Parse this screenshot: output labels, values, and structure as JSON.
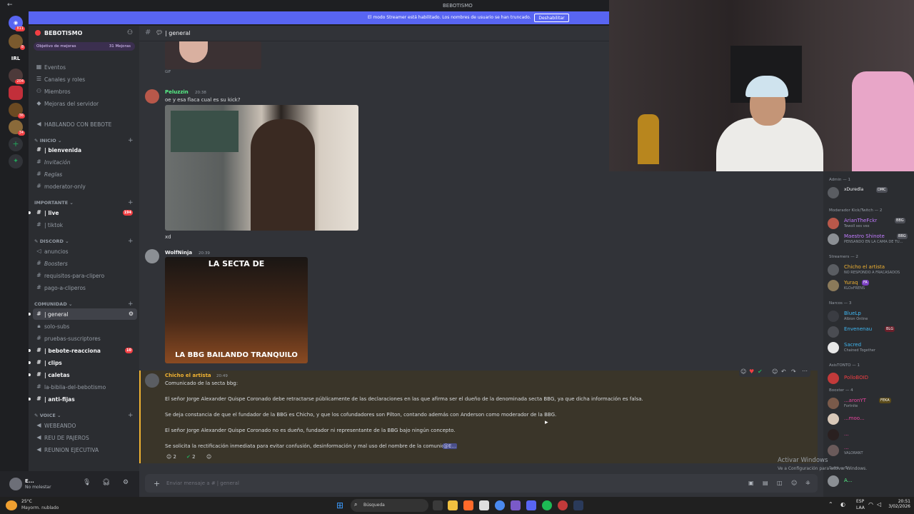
{
  "window": {
    "title": "BEBOTISMO"
  },
  "streamer_bar": {
    "text": "El modo Streamer está habilitado. Los nombres de usuario se han truncado.",
    "button": "Deshabilitar"
  },
  "rail": {
    "badges": [
      "811",
      "8",
      "204",
      "36",
      "34"
    ],
    "label_irl": "IRL"
  },
  "guild": {
    "name": "BEBOTISMO",
    "boost_goal": "Objetivo de mejoras",
    "boost_count": "31 Mejoras",
    "menu": [
      "Eventos",
      "Canales y roles",
      "Miembros",
      "Mejoras del servidor"
    ],
    "hablando": "HABLANDO CON BEBOTE"
  },
  "channels": {
    "cat_inicio": "INICIO",
    "inicio": [
      "| bienvenida",
      "Invitación",
      "Reglas",
      "moderator-only"
    ],
    "cat_importante": "IMPORTANTE",
    "importante": [
      "| live",
      "| tiktok"
    ],
    "live_badge": "194",
    "cat_discord": "DISCORD",
    "discord": [
      "anuncios",
      "Boosters",
      "requisitos-para-clipero",
      "pago-a-cliperos"
    ],
    "cat_comunidad": "COMUNIDAD",
    "comunidad": [
      "| general",
      "solo-subs",
      "pruebas-suscriptores",
      "| bebote-reacciona",
      "| clips",
      "| caletas",
      "la-biblia-del-bebotismo",
      "| anti-fijas"
    ],
    "reacciona_badge": "10",
    "cat_voice": "VOICE",
    "voice": [
      "WEBEANDO",
      "REU DE PAJEROS",
      "REUNION EJECUTIVA"
    ]
  },
  "user": {
    "name": "E...",
    "status": "No molestar"
  },
  "chat": {
    "channel": "| general",
    "gif_label": "GIF",
    "m1": {
      "author": "Peluzzin",
      "time": "20:38",
      "text": "oe y esa flaca cual es su kick?"
    },
    "m1_after": "xd",
    "m2": {
      "author": "WolfNinja",
      "time": "20:39",
      "meme_top": "LA SECTA DE",
      "meme_bottom": "LA BBG BAILANDO TRANQUILO"
    },
    "m3": {
      "author": "Chicho el artista",
      "time": "20:49",
      "lines": [
        "Comunicado de la secta bbg:",
        "El señor Jorge Alexander Quispe Coronado debe retractarse públicamente de las declaraciones en las que afirma ser el dueño de la denominada secta BBG, ya que dicha información es falsa.",
        "Se deja constancia de que el fundador de la BBG es Chicho, y que los cofundadores son Pilton, contando además con Anderson como moderador de la BBG.",
        "El señor Jorge Alexander Quispe Coronado no es dueño, fundador ni representante de la BBG bajo ningún concepto.",
        "Se solicita la rectificación inmediata para evitar confusión, desinformación y mal uso del nombre de la comunidad."
      ],
      "mention": "@E...",
      "reactions": [
        "2",
        "2"
      ]
    },
    "composer_placeholder": "Enviar mensaje a #",
    "composer_channel": "| general"
  },
  "members": {
    "groups": [
      "Admin — 1",
      "Moderador Kick/Twitch — 2",
      "Streamers — 2",
      "Narcos",
      "— 3",
      "AsisTONTO — 1",
      "Booster — 4",
      "Subs — 5"
    ],
    "list": [
      {
        "name": "xDuredla",
        "status": "",
        "tag": "DMC",
        "color": "#f2f3f5"
      },
      {
        "name": "ArianTheFckr",
        "status": "Tewoll ses vex",
        "tag": "BBG",
        "color": "#c27cff"
      },
      {
        "name": "Maestro Shinote",
        "status": "PENSANDO EN LA CAMA DE TU...",
        "tag": "BBG",
        "color": "#c27cff"
      },
      {
        "name": "Chicho el artista",
        "status": "NO RESPONDO A FRACASADOS",
        "tag": "",
        "color": "#f0b232"
      },
      {
        "name": "Yuraq",
        "status": "KLOxFRENS",
        "tag": "FA",
        "color": "#f0b232"
      },
      {
        "name": "BlueLp",
        "status": "Albion Online",
        "tag": "",
        "color": "#3fb7f2"
      },
      {
        "name": "Envenenau",
        "status": "",
        "tag": "BLG",
        "color": "#3fb7f2"
      },
      {
        "name": "Sacred",
        "status": "Chained Together",
        "tag": "",
        "color": "#3fb7f2"
      },
      {
        "name": "PolloBOID",
        "status": "",
        "tag": "",
        "color": "#f23f43"
      },
      {
        "name": "...aronYT",
        "status": "Fortnite",
        "tag": "FEKA",
        "color": "#eb459f"
      },
      {
        "name": "...moo...",
        "status": "",
        "tag": "",
        "color": "#eb459f"
      },
      {
        "name": "...",
        "status": "",
        "tag": "",
        "color": "#eb459f"
      },
      {
        "name": "...",
        "status": "VALORANT",
        "tag": "",
        "color": "#eb459f"
      },
      {
        "name": "A...",
        "status": "",
        "tag": "",
        "color": "#57f287"
      }
    ]
  },
  "activate": {
    "title": "Activar Windows",
    "sub": "Ve a Configuración para activar Windows."
  },
  "taskbar": {
    "temp": "25°C",
    "weather": "Mayorm. nublado",
    "search": "Búsqueda",
    "lang": "ESP",
    "region": "LAA",
    "time": "20:51",
    "date": "3/02/2026"
  },
  "colors": {
    "accent": "#5865f2",
    "announce": "#f0b232",
    "danger": "#f23f43"
  }
}
